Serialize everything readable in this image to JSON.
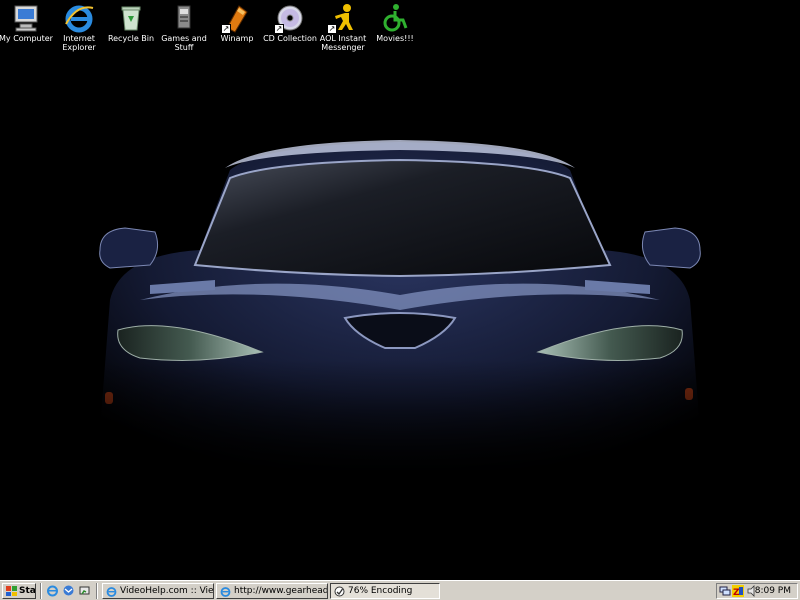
{
  "desktop": {
    "icons": [
      {
        "label": "My Computer",
        "icon": "my-computer-icon"
      },
      {
        "label": "Internet\nExplorer",
        "icon": "internet-explorer-icon"
      },
      {
        "label": "Recycle Bin",
        "icon": "recycle-bin-icon"
      },
      {
        "label": "Games and\nStuff",
        "icon": "folder-icon"
      },
      {
        "label": "Winamp",
        "icon": "winamp-icon"
      },
      {
        "label": "CD Collection",
        "icon": "cd-icon"
      },
      {
        "label": "AOL Instant\nMessenger",
        "icon": "aim-icon"
      },
      {
        "label": "Movies!!!",
        "icon": "movies-icon"
      }
    ],
    "wallpaper": "car-front-wallpaper"
  },
  "taskbar": {
    "start_label": "Start",
    "quick_launch": [
      "internet-explorer-icon",
      "outlook-icon",
      "show-desktop-icon"
    ],
    "tasks": [
      {
        "label": "VideoHelp.com :: View Fo...",
        "icon": "internet-explorer-icon",
        "active": false
      },
      {
        "label": "http://www.gearheadraci...",
        "icon": "internet-explorer-icon",
        "active": false
      },
      {
        "label": "76% Encoding",
        "icon": "encoder-icon",
        "active": true
      }
    ],
    "tray": {
      "icons": [
        "network-icon",
        "zonealarm-icon",
        "volume-icon"
      ],
      "clock": "8:09 PM"
    }
  },
  "colors": {
    "taskbar_bg": "#d4d0c8",
    "desktop_bg": "#000000",
    "car_body": "#1b2548"
  }
}
